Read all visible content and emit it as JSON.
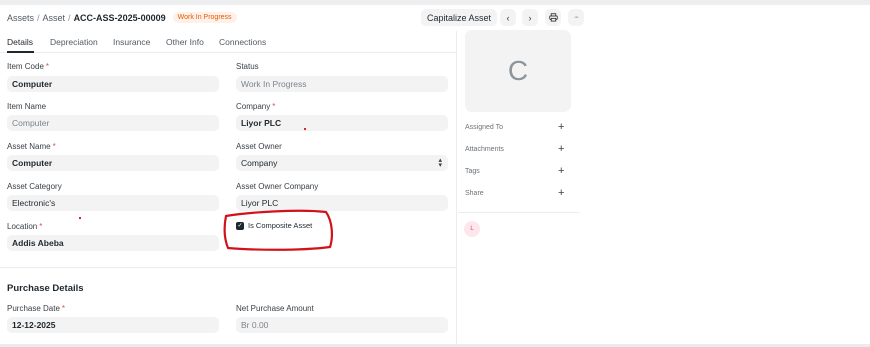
{
  "breadcrumb": {
    "part1": "Assets",
    "part2": "Asset",
    "current": "ACC-ASS-2025-00009",
    "separator": "/",
    "status_badge": "Work In Progress"
  },
  "toolbar": {
    "capitalize_label": "Capitalize Asset",
    "prev_icon": "‹",
    "next_icon": "›",
    "print_icon": "⎙",
    "more_icon": "···"
  },
  "tabs": [
    "Details",
    "Depreciation",
    "Insurance",
    "Other Info",
    "Connections"
  ],
  "form": {
    "item_code": {
      "label": "Item Code",
      "value": "Computer"
    },
    "status": {
      "label": "Status",
      "value": "Work In Progress"
    },
    "item_name": {
      "label": "Item Name",
      "value": "Computer"
    },
    "company": {
      "label": "Company",
      "value": "Liyor PLC"
    },
    "asset_name": {
      "label": "Asset Name",
      "value": "Computer"
    },
    "asset_owner": {
      "label": "Asset Owner",
      "value": "Company"
    },
    "asset_category": {
      "label": "Asset Category",
      "value": "Electronic's"
    },
    "asset_owner_company": {
      "label": "Asset Owner Company",
      "value": "Liyor PLC"
    },
    "location": {
      "label": "Location",
      "value": "Addis Abeba"
    },
    "is_composite": {
      "label": "Is Composite Asset",
      "checked": true
    },
    "required_mark": "*"
  },
  "purchase": {
    "title": "Purchase Details",
    "purchase_date": {
      "label": "Purchase Date",
      "value": "12-12-2025"
    },
    "net_amount": {
      "label": "Net Purchase Amount",
      "value": "Br 0.00"
    }
  },
  "sidebar": {
    "avatar_letter": "C",
    "assigned_to": "Assigned To",
    "attachments": "Attachments",
    "tags": "Tags",
    "share": "Share",
    "plus": "+",
    "user_initial": "L"
  },
  "colors": {
    "badge_text": "#e2590c",
    "badge_bg": "#fff1e7",
    "required": "#e24c4c",
    "annotation": "#d0121b"
  }
}
